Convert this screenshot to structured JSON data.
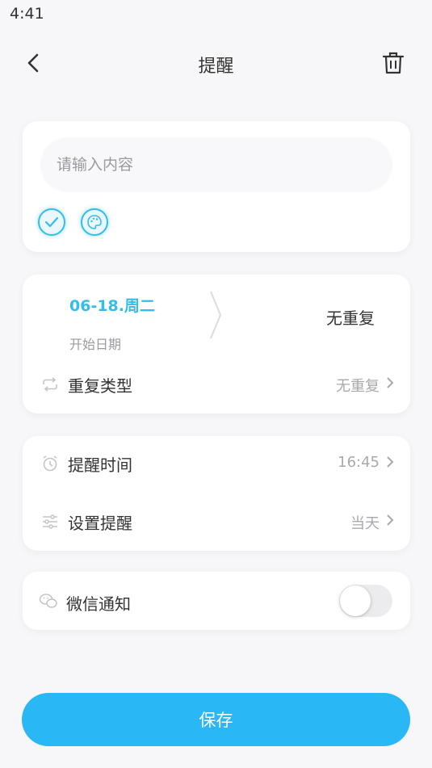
{
  "status_bar": {
    "time": "4:41"
  },
  "header": {
    "title": "提醒"
  },
  "content": {
    "placeholder": "请输入内容"
  },
  "schedule": {
    "start_date": "06-18.周二",
    "start_date_label": "开始日期",
    "repeat_summary": "无重复",
    "repeat_type_label": "重复类型",
    "repeat_type_value": "无重复"
  },
  "reminder": {
    "time_label": "提醒时间",
    "time_value": "16:45",
    "setting_label": "设置提醒",
    "setting_value": "当天"
  },
  "wechat": {
    "label": "微信通知",
    "enabled": false
  },
  "save_label": "保存",
  "colors": {
    "accent": "#33bdea",
    "save_button": "#29b8f5"
  }
}
